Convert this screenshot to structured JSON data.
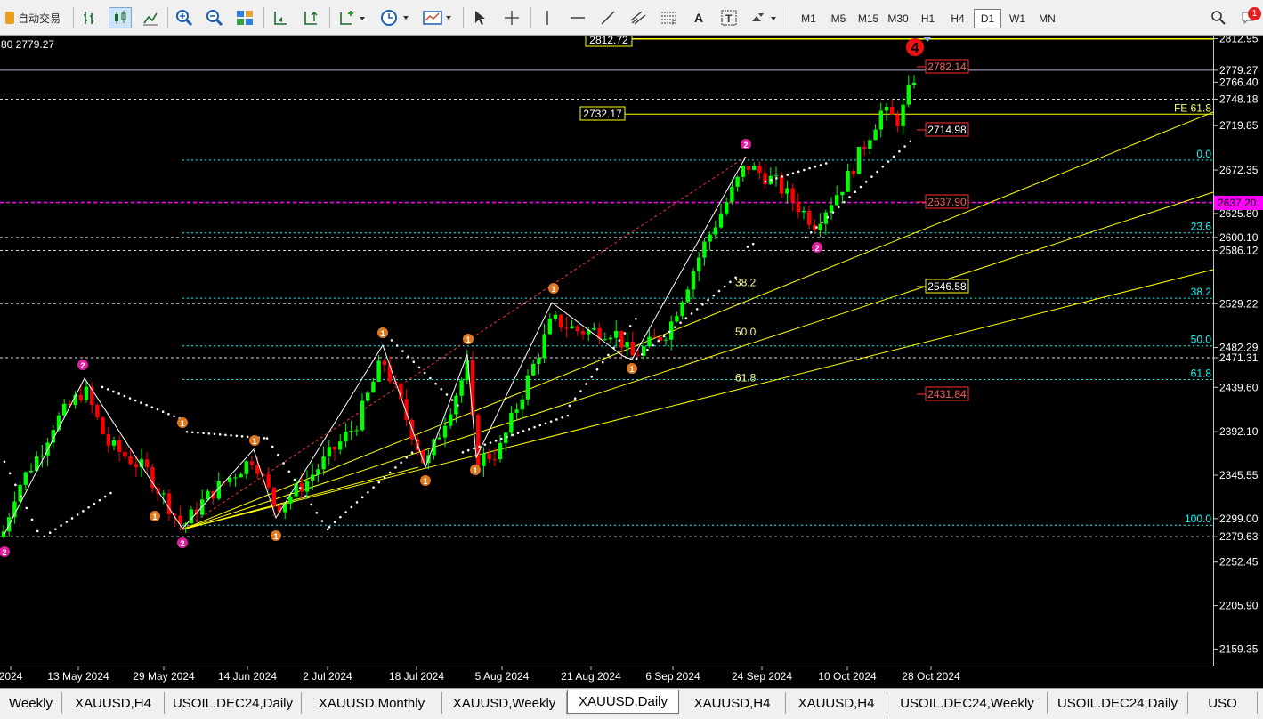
{
  "toolbar": {
    "auto_trade_label": "自动交易",
    "timeframes": [
      "M1",
      "M5",
      "M15",
      "M30",
      "H1",
      "H4",
      "D1",
      "W1",
      "MN"
    ],
    "active_timeframe": "D1",
    "notification_count": "1"
  },
  "chart": {
    "corner_text": "80 2779.27",
    "price_axis": [
      "2812.95",
      "2779.27",
      "2766.40",
      "2748.18",
      "2719.85",
      "2672.35",
      "2625.80",
      "2600.10",
      "2586.12",
      "2529.22",
      "2482.29",
      "2471.31",
      "2439.60",
      "2392.10",
      "2345.55",
      "2299.00",
      "2279.63",
      "2252.45",
      "2205.90",
      "2159.35"
    ],
    "pink_price_label": "2637.20",
    "time_axis": [
      "2024",
      "13 May 2024",
      "29 May 2024",
      "14 Jun 2024",
      "2 Jul 2024",
      "18 Jul 2024",
      "5 Aug 2024",
      "21 Aug 2024",
      "6 Sep 2024",
      "24 Sep 2024",
      "10 Oct 2024",
      "28 Oct 2024"
    ],
    "level_boxes": {
      "top": "2812.72",
      "mid": "2732.17",
      "r1": "2782.14",
      "r2": "2714.98",
      "r3": "2637.90",
      "r4": "2546.58",
      "r5": "2431.84"
    },
    "fib_right": [
      "FE 61.8",
      "0.0",
      "23.6",
      "38.2",
      "50.0",
      "61.8",
      "100.0"
    ],
    "fib_mid": [
      "38.2",
      "50.0",
      "61.8"
    ],
    "wave_label": "4"
  },
  "tabs": [
    "Weekly",
    "XAUUSD,H4",
    "USOIL.DEC24,Daily",
    "XAUUSD,Monthly",
    "XAUUSD,Weekly",
    "XAUUSD,Daily",
    "XAUUSD,H4",
    "XAUUSD,H4",
    "USOIL.DEC24,Weekly",
    "USOIL.DEC24,Daily",
    "USO"
  ],
  "active_tab": "XAUUSD,Daily",
  "colors": {
    "bull": "#00ff00",
    "bear": "#ff0000",
    "fib": "#00ffff",
    "trend": "#ffff00",
    "wave_pink": "#e01e9e",
    "wave_orange": "#e07820"
  }
}
